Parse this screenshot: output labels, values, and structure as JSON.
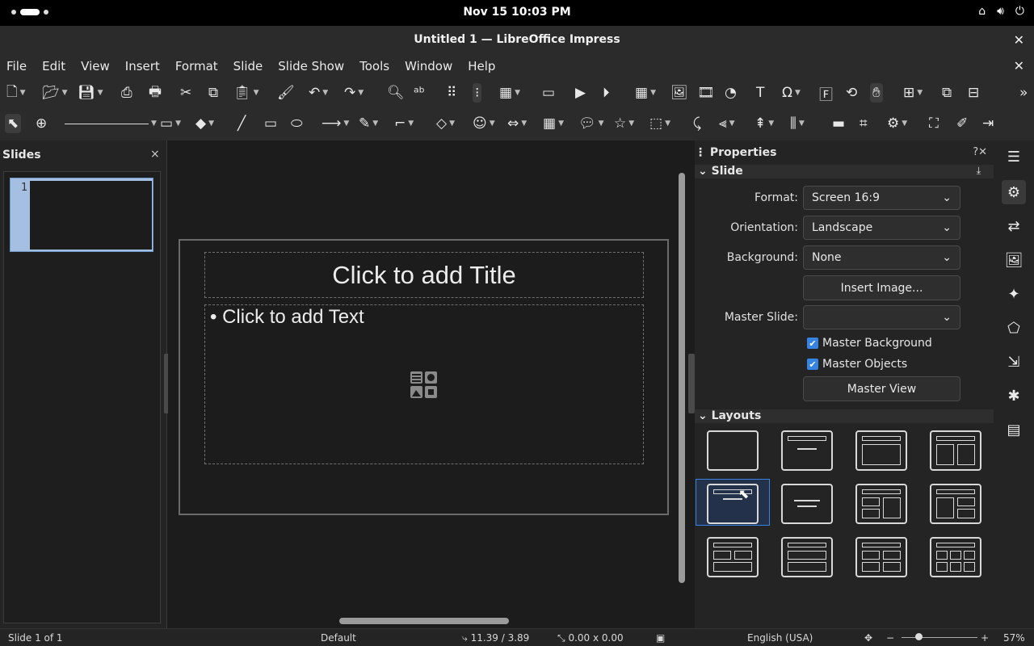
{
  "topbar": {
    "clock": "Nov 15  10:03 PM",
    "tray_icons": [
      "network-icon",
      "volume-icon",
      "power-icon"
    ]
  },
  "window": {
    "title": "Untitled 1 — LibreOffice Impress",
    "close": "✕"
  },
  "menu": [
    "File",
    "Edit",
    "View",
    "Insert",
    "Format",
    "Slide",
    "Slide Show",
    "Tools",
    "Window",
    "Help"
  ],
  "slides_panel": {
    "title": "Slides",
    "close": "×",
    "slide_number": "1"
  },
  "slide": {
    "title_placeholder": "Click to add Title",
    "text_placeholder": "Click to add Text",
    "bullet": "•"
  },
  "properties": {
    "title": "Properties",
    "actions": "?✕",
    "slide_section": "Slide",
    "format_label": "Format:",
    "format_value": "Screen 16:9",
    "orientation_label": "Orientation:",
    "orientation_value": "Landscape",
    "background_label": "Background:",
    "background_value": "None",
    "insert_image": "Insert Image...",
    "master_slide_label": "Master Slide:",
    "master_slide_value": "",
    "master_background": "Master Background",
    "master_objects": "Master Objects",
    "master_view": "Master View",
    "layouts_section": "Layouts"
  },
  "statusbar": {
    "slide_info": "Slide 1 of 1",
    "master": "Default",
    "position": "11.39 / 3.89",
    "size": "0.00 x 0.00",
    "language": "English (USA)",
    "zoom": "57%"
  },
  "colors": {
    "accent": "#3584e4",
    "background": "#1c1c1c",
    "panel": "#242424"
  }
}
